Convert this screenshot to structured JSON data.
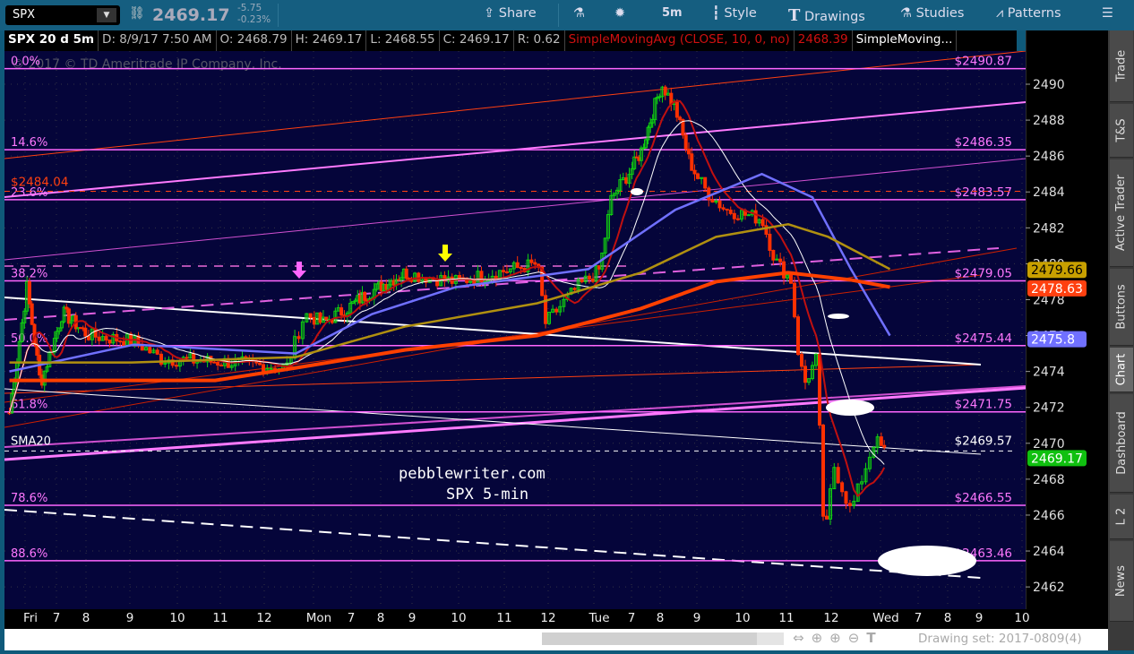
{
  "toolbar": {
    "symbol": "SPX",
    "last": "2469.17",
    "change": "-5.75",
    "change_pct": "-0.23%",
    "share": "Share",
    "timeframe": "5m",
    "style": "Style",
    "drawings": "Drawings",
    "studies": "Studies",
    "patterns": "Patterns"
  },
  "info": {
    "title": "SPX 20 d 5m",
    "date": "D: 8/9/17 7:50 AM",
    "open": "O: 2468.79",
    "high": "H: 2469.17",
    "low": "L: 2468.55",
    "close": "C: 2469.17",
    "range": "R: 0.62",
    "study1": "SimpleMovingAvg (CLOSE, 10, 0, no)",
    "study1_val": "2468.39",
    "study2": "SimpleMoving..."
  },
  "bottom": {
    "drawing_set": "Drawing set: 2017-0809(4)"
  },
  "side_tabs": [
    "Trade",
    "T&S",
    "Active Trader",
    "Buttons",
    "Chart",
    "Dashboard",
    "L 2",
    "News"
  ],
  "chart_data": {
    "type": "candlestick",
    "title": "SPX 5-min",
    "watermark": "pebblewriter.com",
    "copyright": "© 2017 © TD Ameritrade IP Company, Inc.",
    "sma_label": "SMA20",
    "ylim": [
      2461,
      2493
    ],
    "yticks": [
      2462,
      2464,
      2466,
      2468,
      2470,
      2472,
      2474,
      2476,
      2478,
      2480,
      2482,
      2484,
      2486,
      2488,
      2490
    ],
    "xticks": [
      "Fri",
      "7",
      "8",
      "9",
      "10",
      "11",
      "12",
      "Mon",
      "7",
      "8",
      "9",
      "10",
      "11",
      "12",
      "Tue",
      "7",
      "8",
      "9",
      "10",
      "11",
      "12",
      "Wed",
      "7",
      "8",
      "9",
      "10"
    ],
    "price_path": [
      [
        -0.5,
        2471.7
      ],
      [
        0.06,
        2478.7
      ],
      [
        0.49,
        2473.3
      ],
      [
        1.21,
        2477.3
      ],
      [
        2.08,
        2476
      ],
      [
        3.09,
        2475.7
      ],
      [
        3.66,
        2474.7
      ],
      [
        5.29,
        2474.5
      ],
      [
        6.45,
        2474.2
      ],
      [
        6.82,
        2477.2
      ],
      [
        7.24,
        2476.7
      ],
      [
        8.43,
        2478.2
      ],
      [
        9.77,
        2479.5
      ],
      [
        10.94,
        2479
      ],
      [
        12.16,
        2479.7
      ],
      [
        12.75,
        2480
      ],
      [
        12.94,
        2476.7
      ],
      [
        13.64,
        2478.7
      ],
      [
        14.16,
        2479.7
      ],
      [
        14.47,
        2483.7
      ],
      [
        15.32,
        2486.2
      ],
      [
        16.04,
        2490
      ],
      [
        16.41,
        2488.7
      ],
      [
        16.8,
        2485.7
      ],
      [
        17.22,
        2484
      ],
      [
        17.63,
        2483
      ],
      [
        18.44,
        2482.5
      ],
      [
        18.74,
        2480.2
      ],
      [
        19.13,
        2479
      ],
      [
        19.22,
        2475.7
      ],
      [
        19.4,
        2473.3
      ],
      [
        19.67,
        2474.7
      ],
      [
        19.85,
        2464.3
      ],
      [
        20.05,
        2468.8
      ],
      [
        20.4,
        2466.2
      ],
      [
        20.88,
        2470.2
      ],
      [
        21.15,
        2469.4
      ]
    ],
    "series": [
      {
        "name": "SMA blue",
        "color": "#7070ff",
        "points": [
          [
            -0.5,
            2474
          ],
          [
            3.09,
            2475.5
          ],
          [
            6.64,
            2475
          ],
          [
            8.71,
            2477.2
          ],
          [
            10.94,
            2478.7
          ],
          [
            13.88,
            2479.7
          ],
          [
            16.41,
            2483
          ],
          [
            18.44,
            2485
          ],
          [
            19.58,
            2483.7
          ],
          [
            20.4,
            2479.7
          ],
          [
            21.25,
            2476
          ]
        ]
      },
      {
        "name": "SMA orange",
        "color": "#ff4000",
        "points": [
          [
            -0.5,
            2473.5
          ],
          [
            4.88,
            2473.5
          ],
          [
            6.64,
            2474.2
          ],
          [
            9.77,
            2475.2
          ],
          [
            12.75,
            2476
          ],
          [
            15.32,
            2477.5
          ],
          [
            17.42,
            2479
          ],
          [
            19.04,
            2479.5
          ],
          [
            20.4,
            2479.1
          ],
          [
            21.25,
            2478.7
          ]
        ]
      },
      {
        "name": "SMA olive",
        "color": "#b09010",
        "points": [
          [
            -0.5,
            2474.5
          ],
          [
            3.04,
            2474.5
          ],
          [
            6.64,
            2474.8
          ],
          [
            9.77,
            2476.5
          ],
          [
            12.75,
            2477.8
          ],
          [
            15.32,
            2479.5
          ],
          [
            17.42,
            2481.5
          ],
          [
            19.04,
            2482.2
          ],
          [
            19.93,
            2481.5
          ],
          [
            21.25,
            2479.7
          ]
        ]
      }
    ],
    "fib_levels": [
      {
        "pct": "0.0%",
        "price": 2490.87,
        "label": "$2490.87"
      },
      {
        "pct": "14.6%",
        "price": 2486.35,
        "label": "$2486.35"
      },
      {
        "pct": "23.6%",
        "price": 2483.57,
        "label": "$2483.57"
      },
      {
        "pct": "38.2%",
        "price": 2479.05,
        "label": "$2479.05"
      },
      {
        "pct": "50.0%",
        "price": 2475.44,
        "label": "$2475.44"
      },
      {
        "pct": "61.8%",
        "price": 2471.75,
        "label": "$2471.75"
      },
      {
        "pct": "78.6%",
        "price": 2466.55,
        "label": "$2466.55"
      },
      {
        "pct": "88.6%",
        "price": 2463.46,
        "label": "$2463.46"
      }
    ],
    "red_levels": [
      {
        "price": 2484.04,
        "label": "$2484.04"
      }
    ],
    "sma20_level": {
      "price": 2469.57,
      "label": "$2469.57"
    },
    "badges": [
      {
        "value": "2479.66",
        "price": 2479.66,
        "color": "#c8a000",
        "text": "#000"
      },
      {
        "value": "2478.63",
        "price": 2478.63,
        "color": "#ff4010",
        "text": "#fff"
      },
      {
        "value": "2475.8",
        "price": 2475.8,
        "color": "#7070ff",
        "text": "#fff"
      },
      {
        "value": "2469.17",
        "price": 2469.17,
        "color": "#10c010",
        "text": "#fff"
      }
    ]
  }
}
